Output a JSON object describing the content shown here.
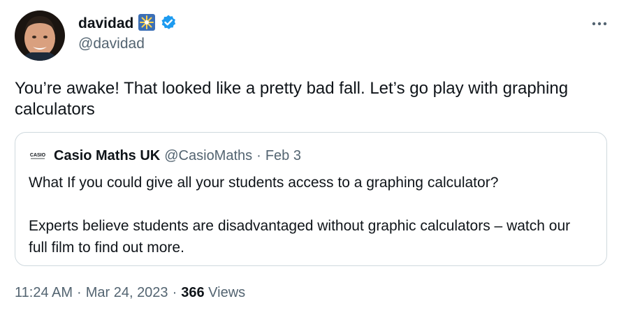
{
  "author": {
    "display_name": "davidad",
    "handle": "@davidad",
    "emoji_icon": "sparkle-emoji-icon",
    "verified_icon": "verified-badge-icon",
    "verified_color": "#1d9bf0"
  },
  "tweet": {
    "text": "You’re awake! That looked like a pretty bad fall. Let’s go play with graphing calculators"
  },
  "quote": {
    "display_name": "Casio Maths UK",
    "handle": "@CasioMaths",
    "separator": "·",
    "date": "Feb 3",
    "avatar_label": "CASIO",
    "paragraph1": "What If you could give all your students access to a graphing calculator?",
    "paragraph2": "Experts believe students are disadvantaged without graphic calculators – watch our full film to find out more."
  },
  "meta": {
    "time": "11:24 AM",
    "dot1": "·",
    "date": "Mar 24, 2023",
    "dot2": "·",
    "views_count": "366",
    "views_label": "Views"
  },
  "colors": {
    "text_primary": "#0f1419",
    "text_secondary": "#536471",
    "border": "#cfd9de",
    "accent": "#1d9bf0"
  }
}
